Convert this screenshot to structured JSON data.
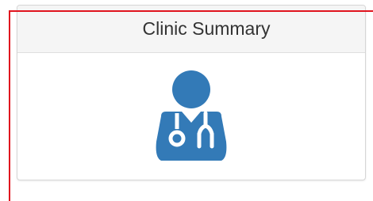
{
  "card": {
    "title": "Clinic Summary",
    "icon": "doctor-stethoscope-icon",
    "icon_color": "#337ab7"
  },
  "colors": {
    "focus_outline": "#e0141e",
    "header_bg": "#f5f5f5",
    "border": "#d6d6d6"
  }
}
